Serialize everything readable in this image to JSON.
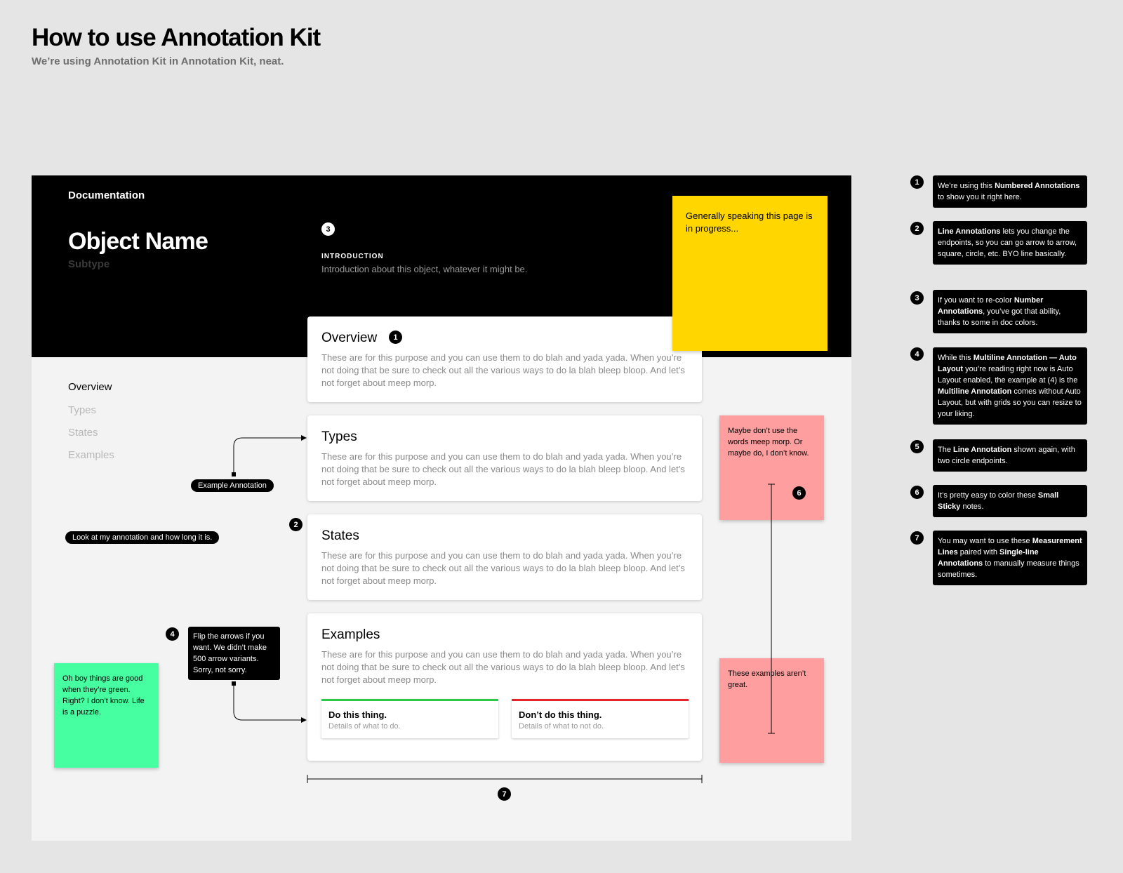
{
  "heading": {
    "title": "How to use Annotation Kit",
    "subtitle": "We’re using Annotation Kit in Annotation Kit, neat."
  },
  "doc": {
    "label": "Documentation",
    "object_name": "Object Name",
    "subtype": "Subtype",
    "intro_heading": "INTRODUCTION",
    "intro_text": "Introduction about this object, whatever it might be."
  },
  "nav": {
    "items": [
      "Overview",
      "Types",
      "States",
      "Examples"
    ]
  },
  "cards": {
    "overview": {
      "title": "Overview",
      "body": "These are for this purpose and you can use them to do blah and yada yada. When you’re not doing that be sure to check out all the various ways to do la blah bleep bloop. And let’s not forget about meep morp."
    },
    "types": {
      "title": "Types",
      "body": "These are for this purpose and you can use them to do blah and yada yada. When you’re not doing that be sure to check out all the various ways to do la blah bleep bloop. And let’s not forget about meep morp."
    },
    "states": {
      "title": "States",
      "body": "These are for this purpose and you can use them to do blah and yada yada. When you’re not doing that be sure to check out all the various ways to do la blah bleep bloop. And let’s not forget about meep morp."
    },
    "examples": {
      "title": "Examples",
      "body": "These are for this purpose and you can use them to do blah and yada yada. When you’re not doing that be sure to check out all the various ways to do la blah bleep bloop. And let’s not forget about meep morp."
    }
  },
  "do": {
    "title": "Do this thing.",
    "desc": "Details of what to do.",
    "color": "#2bc84a"
  },
  "dont": {
    "title": "Don’t do this thing.",
    "desc": "Details of what to not do.",
    "color": "#e5252a"
  },
  "stickies": {
    "yellow": {
      "text": "Generally speaking this page is in progress...",
      "color": "#ffd600"
    },
    "pink_top": {
      "text": "Maybe don’t use the words meep morp. Or maybe do, I don’t know.",
      "color": "#ff9e9e"
    },
    "pink_bottom": {
      "text": "These examples aren’t great.",
      "color": "#ff9e9e"
    },
    "green": {
      "text": "Oh boy things are good when they’re green. Right? I don’t know. Life is a puzzle.",
      "color": "#46ffa0"
    }
  },
  "annotations": {
    "example": "Example Annotation",
    "long": "Look at my annotation and how long it is.",
    "flip_lines": [
      "Flip the arrows if you",
      "want. We didn’t make",
      "500 arrow variants.",
      "Sorry, not sorry."
    ]
  },
  "badges": [
    "1",
    "2",
    "3",
    "4",
    "5",
    "6",
    "7"
  ],
  "legend": [
    {
      "number": "1",
      "parts": [
        [
          "We’re using this ",
          false
        ],
        [
          "Numbered Annotations",
          true
        ],
        [
          " to show you it right here.",
          false
        ]
      ]
    },
    {
      "number": "2",
      "parts": [
        [
          "Line Annotations",
          true
        ],
        [
          " lets you change the endpoints, so you can go arrow to arrow, square, circle, etc. BYO line basically.",
          false
        ]
      ]
    },
    {
      "number": "3",
      "parts": [
        [
          "If you want to re-color ",
          false
        ],
        [
          "Number Annotations",
          true
        ],
        [
          ", you’ve got that ability, thanks to some in doc colors.",
          false
        ]
      ]
    },
    {
      "number": "4",
      "parts": [
        [
          "While this ",
          false
        ],
        [
          "Multiline Annotation — Auto Layout",
          true
        ],
        [
          " you’re reading right now is Auto Layout enabled, the example at (4) is the ",
          false
        ],
        [
          "Multiline Annotation",
          true
        ],
        [
          " comes without Auto Layout, but with grids so you can resize to your liking.",
          false
        ]
      ]
    },
    {
      "number": "5",
      "parts": [
        [
          "The ",
          false
        ],
        [
          "Line Annotation",
          true
        ],
        [
          " shown again, with two circle endpoints.",
          false
        ]
      ]
    },
    {
      "number": "6",
      "parts": [
        [
          "It’s pretty easy to color these ",
          false
        ],
        [
          "Small Sticky",
          true
        ],
        [
          " notes.",
          false
        ]
      ]
    },
    {
      "number": "7",
      "parts": [
        [
          "You may want to use these ",
          false
        ],
        [
          "Measurement Lines",
          true
        ],
        [
          " paired with ",
          false
        ],
        [
          "Single-line Annotations",
          true
        ],
        [
          " to manually measure things sometimes.",
          false
        ]
      ]
    }
  ]
}
